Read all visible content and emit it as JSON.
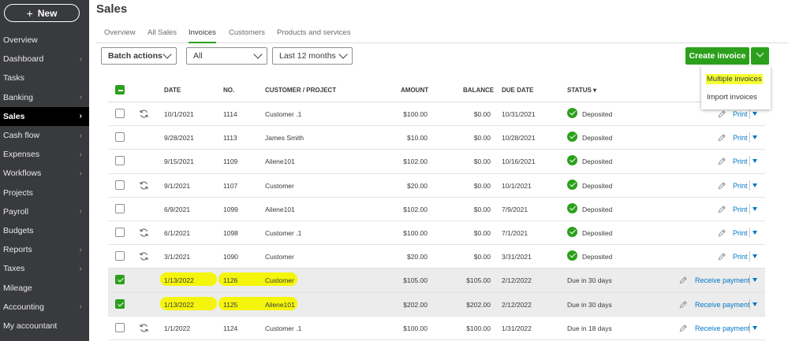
{
  "app": {
    "title": "Sales",
    "new_label": "New"
  },
  "nav": [
    {
      "label": "Overview",
      "chevron": false
    },
    {
      "label": "Dashboard",
      "chevron": true
    },
    {
      "label": "Tasks",
      "chevron": false
    },
    {
      "label": "Banking",
      "chevron": true
    },
    {
      "label": "Sales",
      "chevron": true,
      "active": true
    },
    {
      "label": "Cash flow",
      "chevron": true
    },
    {
      "label": "Expenses",
      "chevron": true
    },
    {
      "label": "Workflows",
      "chevron": true
    },
    {
      "label": "Projects",
      "chevron": false
    },
    {
      "label": "Payroll",
      "chevron": true
    },
    {
      "label": "Budgets",
      "chevron": false
    },
    {
      "label": "Reports",
      "chevron": true
    },
    {
      "label": "Taxes",
      "chevron": true
    },
    {
      "label": "Mileage",
      "chevron": false
    },
    {
      "label": "Accounting",
      "chevron": true
    },
    {
      "label": "My accountant",
      "chevron": false
    }
  ],
  "tabs": [
    "Overview",
    "All Sales",
    "Invoices",
    "Customers",
    "Products and services"
  ],
  "active_tab": "Invoices",
  "toolbar": {
    "batch_actions": "Batch actions",
    "filter_value": "All",
    "date_range": "Last 12 months",
    "create_invoice": "Create invoice"
  },
  "create_menu": [
    "Multiple invoices",
    "Import invoices"
  ],
  "table": {
    "headers": {
      "date": "DATE",
      "no": "NO.",
      "customer": "CUSTOMER / PROJECT",
      "amount": "AMOUNT",
      "balance": "BALANCE",
      "due_date": "DUE DATE",
      "status": "STATUS ▾"
    },
    "rows": [
      {
        "date": "10/1/2021",
        "no": "1114",
        "customer": "Customer .1",
        "amount": "$100.00",
        "balance": "$0.00",
        "due": "10/31/2021",
        "status": "Deposited",
        "action": "Print",
        "checked": false,
        "recurring": true,
        "deposited": true
      },
      {
        "date": "9/28/2021",
        "no": "1113",
        "customer": "James Smith",
        "amount": "$10.00",
        "balance": "$0.00",
        "due": "10/28/2021",
        "status": "Deposited",
        "action": "Print",
        "checked": false,
        "recurring": false,
        "deposited": true
      },
      {
        "date": "9/15/2021",
        "no": "1109",
        "customer": "Ailene101",
        "amount": "$102.00",
        "balance": "$0.00",
        "due": "10/16/2021",
        "status": "Deposited",
        "action": "Print",
        "checked": false,
        "recurring": false,
        "deposited": true
      },
      {
        "date": "9/1/2021",
        "no": "1107",
        "customer": "Customer",
        "amount": "$20.00",
        "balance": "$0.00",
        "due": "10/1/2021",
        "status": "Deposited",
        "action": "Print",
        "checked": false,
        "recurring": true,
        "deposited": true
      },
      {
        "date": "6/9/2021",
        "no": "1099",
        "customer": "Ailene101",
        "amount": "$102.00",
        "balance": "$0.00",
        "due": "7/9/2021",
        "status": "Deposited",
        "action": "Print",
        "checked": false,
        "recurring": false,
        "deposited": true
      },
      {
        "date": "6/1/2021",
        "no": "1098",
        "customer": "Customer .1",
        "amount": "$100.00",
        "balance": "$0.00",
        "due": "7/1/2021",
        "status": "Deposited",
        "action": "Print",
        "checked": false,
        "recurring": true,
        "deposited": true
      },
      {
        "date": "3/1/2021",
        "no": "1090",
        "customer": "Customer",
        "amount": "$20.00",
        "balance": "$0.00",
        "due": "3/31/2021",
        "status": "Deposited",
        "action": "Print",
        "checked": false,
        "recurring": true,
        "deposited": true
      },
      {
        "date": "1/13/2022",
        "no": "1126",
        "customer": "Customer",
        "amount": "$105.00",
        "balance": "$105.00",
        "due": "2/12/2022",
        "status": "Due in 30 days",
        "action": "Receive payment",
        "checked": true,
        "recurring": false,
        "deposited": false,
        "highlight": true
      },
      {
        "date": "1/13/2022",
        "no": "1125",
        "customer": "Ailene101",
        "amount": "$202.00",
        "balance": "$202.00",
        "due": "2/12/2022",
        "status": "Due in 30 days",
        "action": "Receive payment",
        "checked": true,
        "recurring": false,
        "deposited": false,
        "highlight": true
      },
      {
        "date": "1/1/2022",
        "no": "1124",
        "customer": "Customer .1",
        "amount": "$100.00",
        "balance": "$100.00",
        "due": "1/31/2022",
        "status": "Due in 18 days",
        "action": "Receive payment",
        "checked": false,
        "recurring": true,
        "deposited": false
      }
    ]
  },
  "colors": {
    "sidebar_bg": "#393a3d",
    "brand_green": "#2ca01c",
    "link_blue": "#0077c5",
    "highlight_yellow": "#f5ff32"
  },
  "icons": {
    "recurring": "refresh-icon",
    "edit": "pencil-icon",
    "status_ok": "check-circle-icon",
    "chevron": "chevron-right-icon"
  }
}
